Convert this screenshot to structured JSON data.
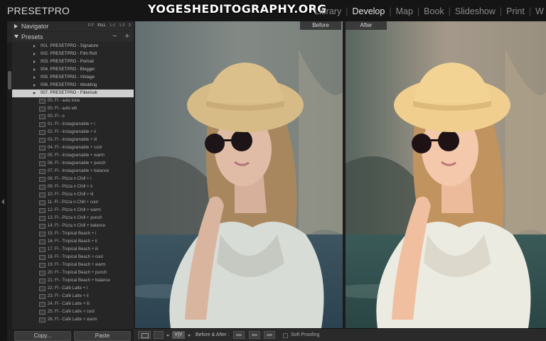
{
  "app": {
    "brand": "PRESETPRO",
    "watermark": "YOGESHEDITOGRAPHY.ORG"
  },
  "modules": [
    {
      "label": "Library",
      "active": false
    },
    {
      "label": "Develop",
      "active": true
    },
    {
      "label": "Map",
      "active": false
    },
    {
      "label": "Book",
      "active": false
    },
    {
      "label": "Slideshow",
      "active": false
    },
    {
      "label": "Print",
      "active": false
    },
    {
      "label": "W",
      "active": false
    }
  ],
  "navigator": {
    "title": "Navigator",
    "zoom_options": [
      {
        "label": "FIT",
        "active": false
      },
      {
        "label": "FILL",
        "active": true
      },
      {
        "label": "1:1",
        "active": false
      },
      {
        "label": "1:2",
        "active": false
      },
      {
        "label": "3",
        "active": false
      }
    ]
  },
  "presets": {
    "title": "Presets",
    "minus": "−",
    "plus": "+",
    "folders": [
      {
        "label": "001. PRESETPRO - Signature",
        "open": false
      },
      {
        "label": "002. PRESETPRO - Film Roll",
        "open": false
      },
      {
        "label": "003. PRESETPRO - Portrait",
        "open": false
      },
      {
        "label": "004. PRESETPRO - Blogger",
        "open": false
      },
      {
        "label": "005. PRESETPRO - Vintage",
        "open": false
      },
      {
        "label": "006. PRESETPRO - Wedding",
        "open": false
      },
      {
        "label": "007. PRESETPRO - Filterlook",
        "open": true
      }
    ],
    "items": [
      "00. Fl - auto tone",
      "00. Fl - auto wb",
      "00. Fl - o",
      "01. Fl - Instagramable + i",
      "02. Fl - Instagramable + ii",
      "03. Fl - Instagramable + iii",
      "04. Fl - Instagramable + cool",
      "05. Fl - Instagramable + warm",
      "06. Fl - Instagramable + punch",
      "07. Fl - Instagramable + balance",
      "08. Fl - Pizza n Chill + i",
      "09. Fl - Pizza n Chill + ii",
      "10. Fl - Pizza n Chill + iii",
      "11. Fl - Pizza n Chill + cool",
      "12. Fl - Pizza n Chill + warm",
      "13. Fl - Pizza n Chill + punch",
      "14. Fl - Pizza n Chill + balance",
      "15. Fl - Tropical Beach + i",
      "16. Fl - Tropical Beach + ii",
      "17. Fl - Tropical Beach + iii",
      "18. Fl - Tropical Beach + cool",
      "19. Fl - Tropical Beach + warm",
      "20. Fl - Tropical Beach + punch",
      "21. Fl - Tropical Beach + balance",
      "22. Fl - Café Latte + i",
      "23. Fl - Café Latte + ii",
      "24. Fl - Café Latte + iii",
      "25. Fl - Café Latte + cool",
      "26. Fl - Café Latte + warm"
    ]
  },
  "buttons": {
    "copy": "Copy...",
    "paste": "Paste"
  },
  "compare": {
    "before_label": "Before",
    "after_label": "After"
  },
  "toolbar": {
    "yy_label": "Y|Y",
    "before_after_label": "Before & After :",
    "soft_proofing_label": "Soft Proofing"
  }
}
